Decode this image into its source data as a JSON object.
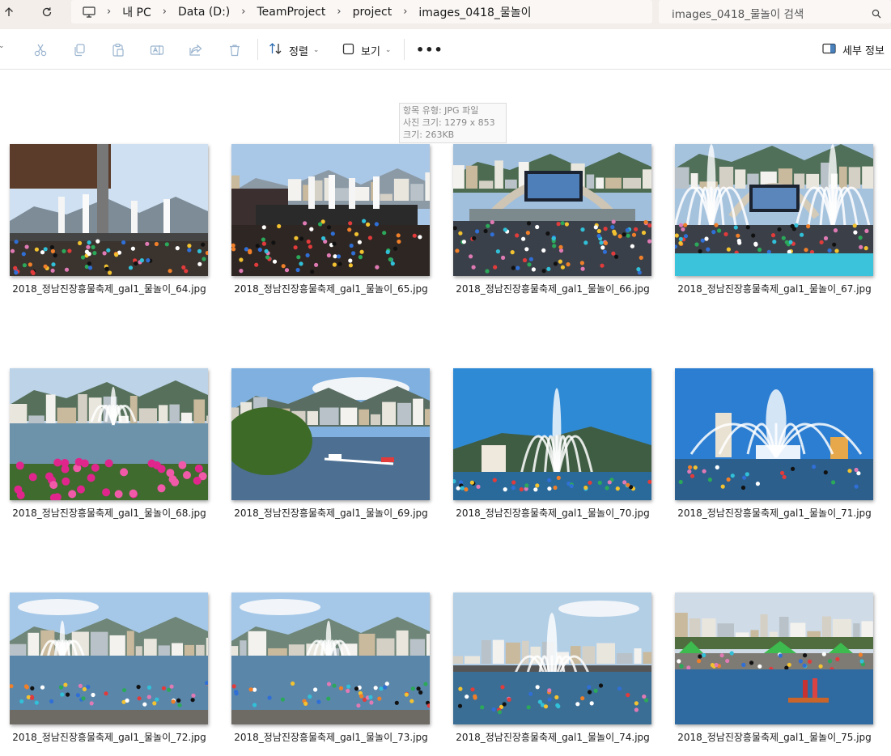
{
  "breadcrumb": {
    "items": [
      "내 PC",
      "Data (D:)",
      "TeamProject",
      "project",
      "images_0418_물놀이"
    ]
  },
  "search": {
    "placeholder": "images_0418_물놀이 검색"
  },
  "toolbar": {
    "sort_label": "정렬",
    "view_label": "보기",
    "details_label": "세부 정보"
  },
  "tooltip": {
    "line1": "항목 유형: JPG 파일",
    "line2": "사진 크기: 1279 x 853",
    "line3": "크기: 263KB"
  },
  "files": [
    {
      "name": "2018_정남진장흥물축제_gal1_물놀이_64.jpg",
      "scene": "stage-crowd"
    },
    {
      "name": "2018_정남진장흥물축제_gal1_물놀이_65.jpg",
      "scene": "stage-dancers"
    },
    {
      "name": "2018_정남진장흥물축제_gal1_물놀이_66.jpg",
      "scene": "arena-screen"
    },
    {
      "name": "2018_정남진장흥물축제_gal1_물놀이_67.jpg",
      "scene": "arena-fountain"
    },
    {
      "name": "2018_정남진장흥물축제_gal1_물놀이_68.jpg",
      "scene": "river-flowers"
    },
    {
      "name": "2018_정남진장흥물축제_gal1_물놀이_69.jpg",
      "scene": "river-boat"
    },
    {
      "name": "2018_정남진장흥물축제_gal1_물놀이_70.jpg",
      "scene": "fountain-mountain"
    },
    {
      "name": "2018_정남진장흥물축제_gal1_물놀이_71.jpg",
      "scene": "fountain-sky"
    },
    {
      "name": "2018_정남진장흥물축제_gal1_물놀이_72.jpg",
      "scene": "river-people"
    },
    {
      "name": "2018_정남진장흥물축제_gal1_물놀이_73.jpg",
      "scene": "river-people"
    },
    {
      "name": "2018_정남진장흥물축제_gal1_물놀이_74.jpg",
      "scene": "fountain-city"
    },
    {
      "name": "2018_정남진장흥물축제_gal1_물놀이_75.jpg",
      "scene": "raft-tents"
    }
  ],
  "colors": {
    "address_bg": "#f3eeea",
    "field_bg": "#faf7f5",
    "icon_disabled": "#9ab4cf"
  }
}
